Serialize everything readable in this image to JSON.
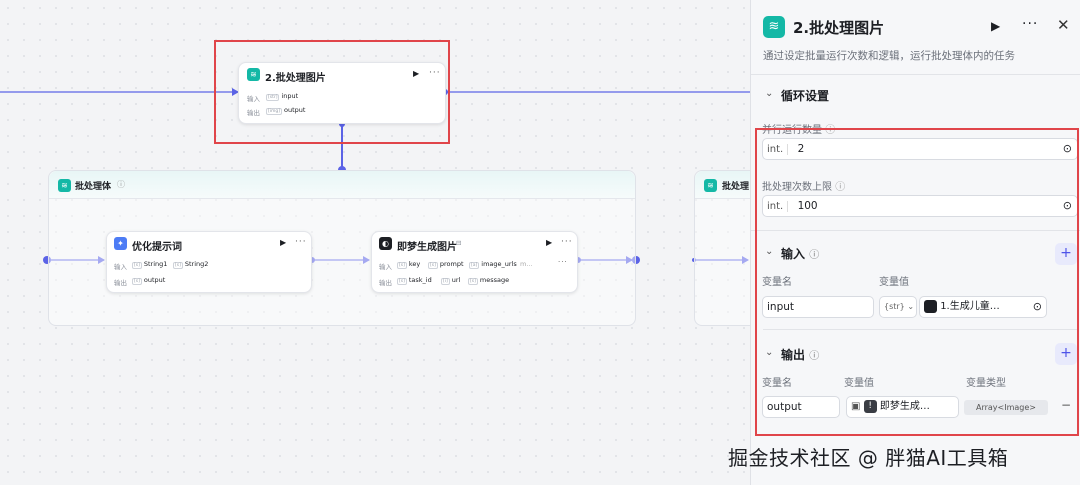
{
  "canvas": {
    "selected_node": {
      "title": "2.批处理图片",
      "input_label": "输入",
      "input_var": "input",
      "output_label": "输出",
      "output_var": "output"
    },
    "group": {
      "title": "批处理体",
      "info": "ⓘ"
    },
    "group_right": {
      "title": "批处理"
    },
    "optimize_node": {
      "title": "优化提示词",
      "input_label": "输入",
      "inputs": [
        "String1",
        "String2"
      ],
      "output_label": "输出",
      "outputs": [
        "output"
      ]
    },
    "dream_node": {
      "title": "即梦生成图片",
      "input_label": "输入",
      "inputs": [
        "key",
        "prompt",
        "image_urls",
        "m..."
      ],
      "output_label": "输出",
      "outputs": [
        "task_id",
        "url",
        "message"
      ]
    }
  },
  "panel": {
    "title": "2.批处理图片",
    "description": "通过设定批量运行次数和逻辑，运行批处理体内的任务",
    "loop_section": "循环设置",
    "parallel_label": "并行运行数量",
    "parallel_type": "int.",
    "parallel_value": "2",
    "limit_label": "批处理次数上限",
    "limit_type": "int.",
    "limit_value": "100",
    "input_section": "输入",
    "input_col_name": "变量名",
    "input_col_value": "变量值",
    "input_var_name": "input",
    "input_var_type": "{str}",
    "input_ref": "1.生成儿童…",
    "output_section": "输出",
    "output_col_name": "变量名",
    "output_col_value": "变量值",
    "output_col_type": "变量类型",
    "output_var_name": "output",
    "output_ref": "即梦生成…",
    "output_type": "Array<Image>"
  },
  "watermark": "掘金技术社区 @ 胖猫AI工具箱",
  "colors": {
    "accent": "#4d53e8",
    "teal": "#14b8a6",
    "red_box": "#e0454a"
  }
}
